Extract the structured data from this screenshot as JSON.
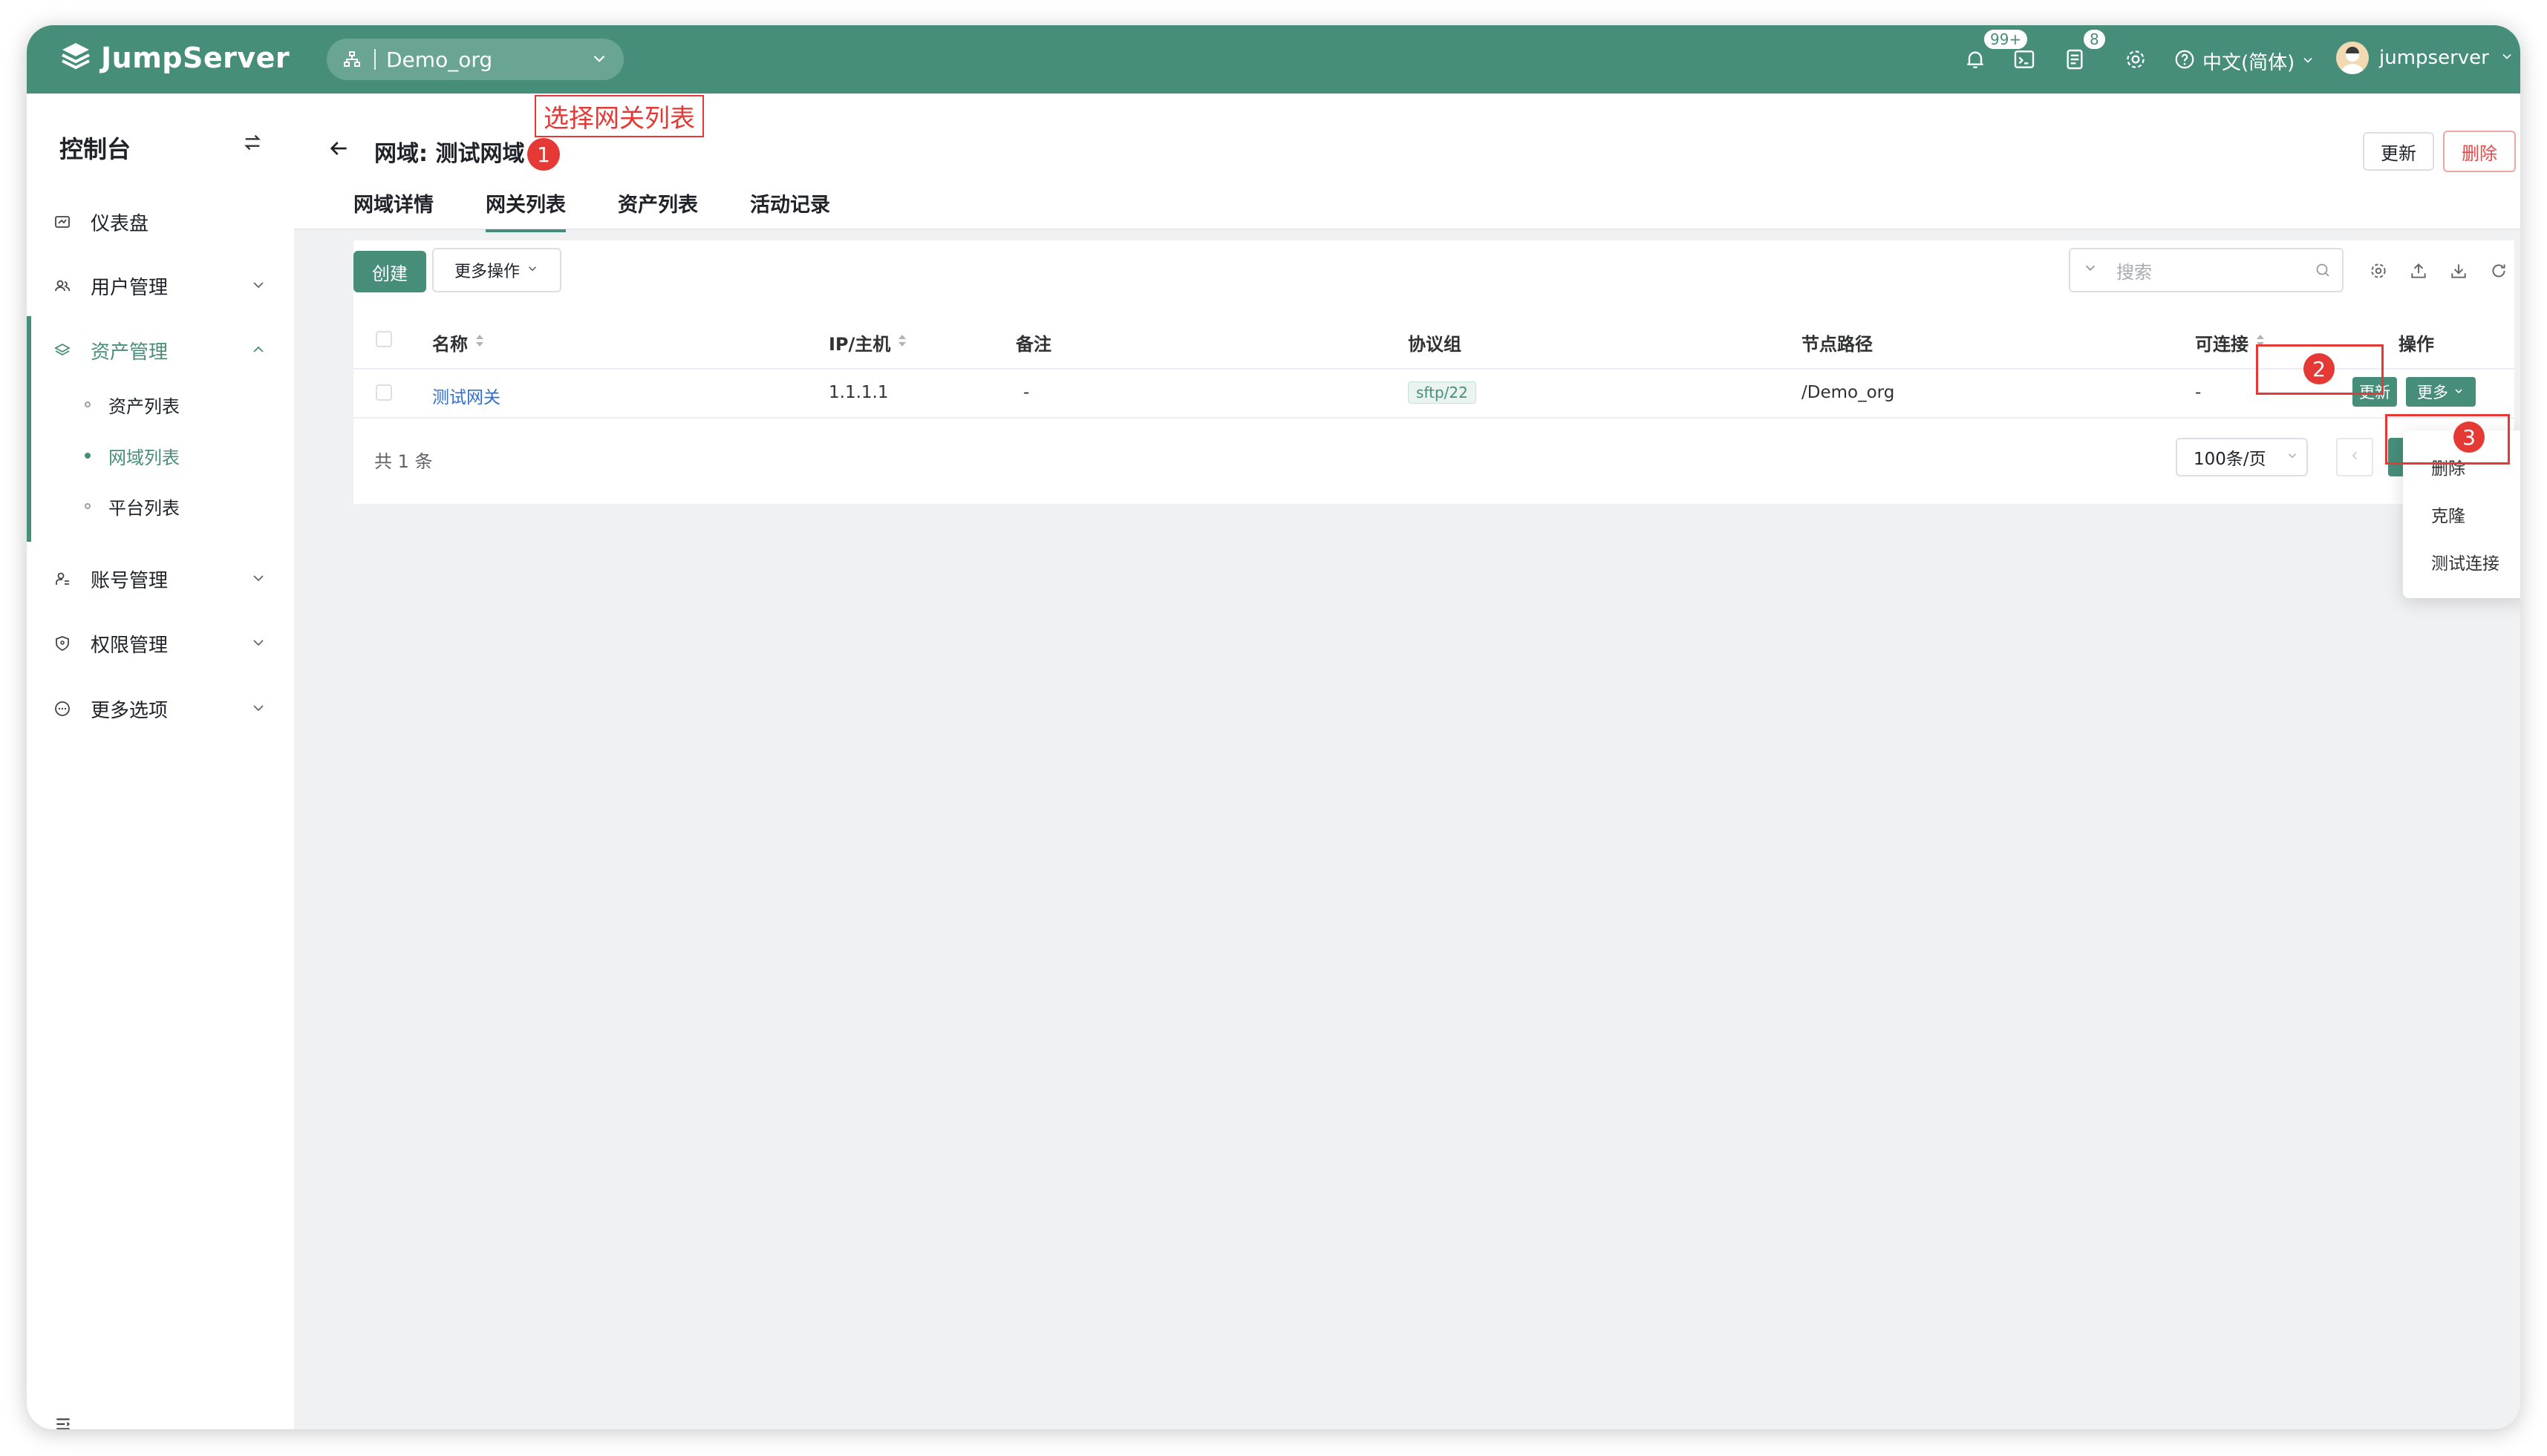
{
  "app": {
    "logo_text": "JumpServer",
    "org": "Demo_org",
    "notifications_badge": "99+",
    "tasks_badge": "8",
    "language": "中文(简体)",
    "username": "jumpserver"
  },
  "sidebar": {
    "title": "控制台",
    "items": [
      {
        "label": "仪表盘",
        "icon": "dashboard-icon"
      },
      {
        "label": "用户管理",
        "icon": "users-icon"
      },
      {
        "label": "资产管理",
        "icon": "layers-icon"
      },
      {
        "label": "账号管理",
        "icon": "accounts-icon"
      },
      {
        "label": "权限管理",
        "icon": "shield-icon"
      },
      {
        "label": "更多选项",
        "icon": "more-options-icon"
      }
    ],
    "sub_items": [
      {
        "label": "资产列表"
      },
      {
        "label": "网域列表"
      },
      {
        "label": "平台列表"
      }
    ]
  },
  "page": {
    "title": "网域: 测试网域",
    "update_label": "更新",
    "delete_label": "删除",
    "tabs": [
      {
        "label": "网域详情"
      },
      {
        "label": "网关列表"
      },
      {
        "label": "资产列表"
      },
      {
        "label": "活动记录"
      }
    ]
  },
  "annotations": {
    "label_1": "选择网关列表",
    "step_1": "1",
    "step_2": "2",
    "step_3": "3"
  },
  "toolbar": {
    "create_label": "创建",
    "more_ops_label": "更多操作",
    "search_placeholder": "搜索"
  },
  "table": {
    "columns": [
      "名称",
      "IP/主机",
      "备注",
      "协议组",
      "节点路径",
      "可连接",
      "操作"
    ],
    "rows": [
      {
        "name": "测试网关",
        "ip": "1.1.1.1",
        "comment": "-",
        "protocols": "sftp/22",
        "node_path": "/Demo_org",
        "connectivity": "-",
        "update_label": "更新",
        "more_label": "更多"
      }
    ],
    "total": "共 1 条",
    "page_size": "100条/页"
  },
  "dropdown": {
    "items": [
      "删除",
      "克隆",
      "测试连接"
    ]
  },
  "colors": {
    "primary": "#478e7a",
    "annotation": "#e53935",
    "danger": "#e54848"
  }
}
